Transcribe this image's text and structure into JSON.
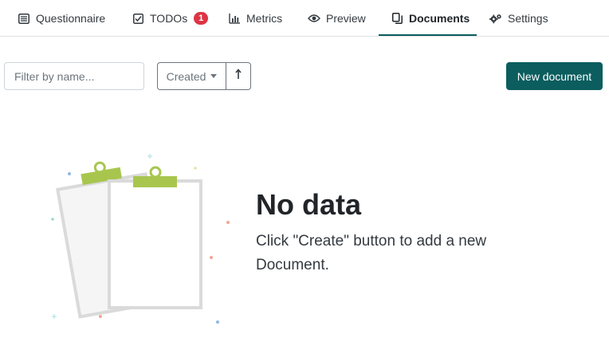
{
  "tabs": [
    {
      "label": "Questionnaire",
      "icon": "list-icon"
    },
    {
      "label": "TODOs",
      "icon": "checkbox-icon",
      "badge": "1"
    },
    {
      "label": "Metrics",
      "icon": "bar-chart-icon"
    },
    {
      "label": "Preview",
      "icon": "eye-icon"
    },
    {
      "label": "Documents",
      "icon": "documents-icon",
      "active": true
    },
    {
      "label": "Settings",
      "icon": "gears-icon"
    }
  ],
  "toolbar": {
    "filter_placeholder": "Filter by name...",
    "filter_value": "",
    "sort_label": "Created",
    "order_icon": "arrow-up-icon",
    "new_document_label": "New document"
  },
  "empty_state": {
    "title": "No data",
    "message": "Click \"Create\" button to add a new Document."
  },
  "colors": {
    "accent": "#0b5d5e",
    "badge": "#dc3545",
    "clip": "#a8c64e"
  }
}
